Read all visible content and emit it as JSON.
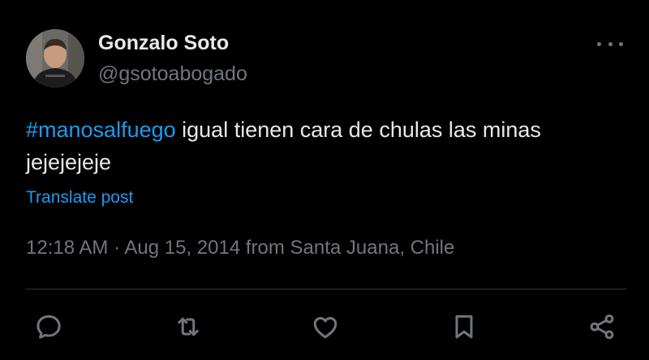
{
  "author": {
    "display_name": "Gonzalo Soto",
    "handle": "@gsotoabogado"
  },
  "post": {
    "hashtag": "#manosalfuego",
    "text": " igual tienen cara de chulas las minas jejejejeje",
    "translate_label": "Translate post",
    "timestamp": "12:18 AM · Aug 15, 2014 from Santa Juana, Chile"
  },
  "actions": {
    "icons": [
      "reply-icon",
      "repost-icon",
      "like-icon",
      "bookmark-icon",
      "share-icon"
    ]
  },
  "colors": {
    "background": "#000000",
    "primary_text": "#e7e9ea",
    "secondary_text": "#71767b",
    "link": "#1d9bf0",
    "divider": "#2f3336"
  }
}
